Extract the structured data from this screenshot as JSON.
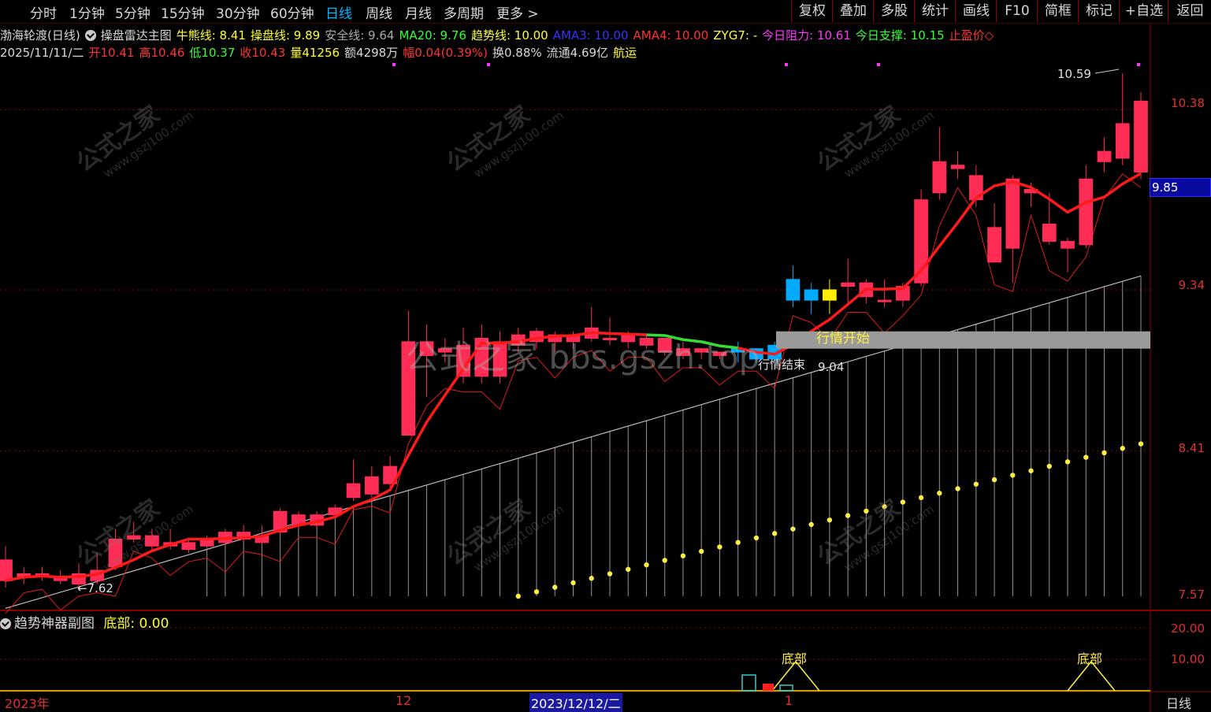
{
  "tabs": [
    "分时",
    "1分钟",
    "5分钟",
    "15分钟",
    "30分钟",
    "60分钟",
    "日线",
    "周线",
    "月线",
    "多周期",
    "更多 >"
  ],
  "active_tab": "日线",
  "right_buttons": [
    "复权",
    "叠加",
    "多股",
    "统计",
    "画线",
    "F10",
    "简框",
    "标记",
    "+自选",
    "返回"
  ],
  "indicator_line": {
    "stock": "渤海轮渡(日线)",
    "formula": "操盘雷达主图",
    "items": [
      {
        "text": "牛熊线: 8.41",
        "color": "#ffff33"
      },
      {
        "text": "操盘线: 9.89",
        "color": "#ffff33"
      },
      {
        "text": "安全线: 9.64",
        "color": "#aaaaaa"
      },
      {
        "text": "MA20: 9.76",
        "color": "#33ff33"
      },
      {
        "text": "趋势线: 10.00",
        "color": "#ffff33"
      },
      {
        "text": "AMA3: 10.00",
        "color": "#3333ff"
      },
      {
        "text": "AMA4: 10.00",
        "color": "#ff3333"
      },
      {
        "text": "ZYG7: -",
        "color": "#ffff33"
      },
      {
        "text": "今日阻力: 10.61",
        "color": "#ff33ff"
      },
      {
        "text": "今日支撑: 10.15",
        "color": "#33ff33"
      },
      {
        "text": "止盈价◇",
        "color": "#ff3333"
      }
    ]
  },
  "quote_line": {
    "date": "2025/11/11/二",
    "items": [
      {
        "text": "开10.41",
        "color": "#ff3333"
      },
      {
        "text": "高10.46",
        "color": "#ff3333"
      },
      {
        "text": "低10.37",
        "color": "#33ff33"
      },
      {
        "text": "收10.43",
        "color": "#ff3333"
      },
      {
        "text": "量41256",
        "color": "#ffff33"
      },
      {
        "text": "额4298万",
        "color": "#d8d8d8"
      },
      {
        "text": "幅0.04(0.39%)",
        "color": "#ff3333"
      },
      {
        "text": "换0.88%",
        "color": "#d8d8d8"
      },
      {
        "text": "流通4.69亿",
        "color": "#d8d8d8"
      },
      {
        "text": "航运",
        "color": "#ffff33"
      }
    ]
  },
  "y_axis_labels": [
    "10.38",
    "9.34",
    "8.41",
    "7.57"
  ],
  "current_price_tag": "9.85",
  "annotations": {
    "high_label": "10.59",
    "low_label": "7.62",
    "start_label": "行情开始",
    "end_label": "行情结束",
    "end_value": "9.04"
  },
  "sub_chart": {
    "title": "趋势神器副图",
    "value_label": "底部: 0.00",
    "y_labels": [
      "20.00",
      "10.00"
    ],
    "marker_label": "底部"
  },
  "x_axis_labels": [
    "2023年",
    "12",
    "2023/12/12/二",
    "1"
  ],
  "period_label": "日线",
  "watermark": {
    "title": "公式之家",
    "url": "www.gszj100.com",
    "big": "公式之家 bbs.gszh.top"
  },
  "colors": {
    "up": "#ff2d55",
    "down": "#00aaff",
    "ma": "#ff1a1a",
    "grid": "#8b0000",
    "accent": "#00b4ff"
  },
  "candles": [
    {
      "o": 7.78,
      "c": 7.66,
      "h": 7.86,
      "l": 7.62
    },
    {
      "o": 7.68,
      "c": 7.7,
      "h": 7.74,
      "l": 7.64
    },
    {
      "o": 7.7,
      "c": 7.7,
      "h": 7.74,
      "l": 7.66
    },
    {
      "o": 7.68,
      "c": 7.66,
      "h": 7.72,
      "l": 7.64
    },
    {
      "o": 7.64,
      "c": 7.7,
      "h": 7.76,
      "l": 7.62
    },
    {
      "o": 7.66,
      "c": 7.72,
      "h": 7.82,
      "l": 7.64
    },
    {
      "o": 7.74,
      "c": 7.9,
      "h": 7.96,
      "l": 7.72
    },
    {
      "o": 7.9,
      "c": 7.92,
      "h": 8.0,
      "l": 7.88
    },
    {
      "o": 7.86,
      "c": 7.92,
      "h": 7.96,
      "l": 7.84
    },
    {
      "o": 7.86,
      "c": 7.88,
      "h": 7.96,
      "l": 7.84
    },
    {
      "o": 7.84,
      "c": 7.88,
      "h": 7.9,
      "l": 7.82
    },
    {
      "o": 7.86,
      "c": 7.9,
      "h": 7.92,
      "l": 7.84
    },
    {
      "o": 7.88,
      "c": 7.94,
      "h": 7.96,
      "l": 7.86
    },
    {
      "o": 7.9,
      "c": 7.94,
      "h": 7.98,
      "l": 7.88
    },
    {
      "o": 7.88,
      "c": 7.92,
      "h": 7.98,
      "l": 7.86
    },
    {
      "o": 7.94,
      "c": 8.06,
      "h": 8.08,
      "l": 7.92
    },
    {
      "o": 7.98,
      "c": 8.04,
      "h": 8.06,
      "l": 7.96
    },
    {
      "o": 7.98,
      "c": 8.04,
      "h": 8.06,
      "l": 7.96
    },
    {
      "o": 8.04,
      "c": 8.08,
      "h": 8.1,
      "l": 8.02
    },
    {
      "o": 8.14,
      "c": 8.22,
      "h": 8.36,
      "l": 8.12
    },
    {
      "o": 8.16,
      "c": 8.26,
      "h": 8.32,
      "l": 8.14
    },
    {
      "o": 8.22,
      "c": 8.32,
      "h": 8.38,
      "l": 8.2
    },
    {
      "o": 8.5,
      "c": 9.04,
      "h": 9.22,
      "l": 8.5
    },
    {
      "o": 8.96,
      "c": 9.04,
      "h": 9.14,
      "l": 8.72
    },
    {
      "o": 8.98,
      "c": 9.0,
      "h": 9.06,
      "l": 8.92
    },
    {
      "o": 8.84,
      "c": 9.02,
      "h": 9.12,
      "l": 8.8
    },
    {
      "o": 8.84,
      "c": 9.06,
      "h": 9.14,
      "l": 8.8
    },
    {
      "o": 8.84,
      "c": 9.04,
      "h": 9.1,
      "l": 8.8
    },
    {
      "o": 9.02,
      "c": 9.08,
      "h": 9.12,
      "l": 8.98
    },
    {
      "o": 9.04,
      "c": 9.1,
      "h": 9.12,
      "l": 9.0
    },
    {
      "o": 9.04,
      "c": 9.08,
      "h": 9.1,
      "l": 8.98
    },
    {
      "o": 9.04,
      "c": 9.08,
      "h": 9.1,
      "l": 9.0
    },
    {
      "o": 9.06,
      "c": 9.12,
      "h": 9.24,
      "l": 9.04
    },
    {
      "o": 9.06,
      "c": 9.06,
      "h": 9.18,
      "l": 9.02
    },
    {
      "o": 9.04,
      "c": 9.08,
      "h": 9.1,
      "l": 9.0
    },
    {
      "o": 9.02,
      "c": 9.06,
      "h": 9.08,
      "l": 9.0
    },
    {
      "o": 8.98,
      "c": 9.06,
      "h": 9.06,
      "l": 8.96
    },
    {
      "o": 8.96,
      "c": 9.0,
      "h": 9.04,
      "l": 8.94
    },
    {
      "o": 8.98,
      "c": 9.0,
      "h": 9.0,
      "l": 8.94
    },
    {
      "o": 8.98,
      "c": 8.96,
      "h": 8.98,
      "l": 8.94
    },
    {
      "o": 8.98,
      "c": 9.0,
      "h": 9.04,
      "l": 8.92
    },
    {
      "o": 9.0,
      "c": 8.94,
      "h": 9.0,
      "l": 8.92
    },
    {
      "o": 9.02,
      "c": 8.94,
      "h": 9.04,
      "l": 8.92
    },
    {
      "o": 9.4,
      "c": 9.28,
      "h": 9.48,
      "l": 9.24
    },
    {
      "o": 9.28,
      "c": 9.34,
      "h": 9.38,
      "l": 9.2
    },
    {
      "o": 9.28,
      "c": 9.34,
      "h": 9.4,
      "l": 9.2
    },
    {
      "o": 9.36,
      "c": 9.38,
      "h": 9.52,
      "l": 9.26
    },
    {
      "o": 9.3,
      "c": 9.38,
      "h": 9.4,
      "l": 9.26
    },
    {
      "o": 9.28,
      "c": 9.28,
      "h": 9.4,
      "l": 9.24
    },
    {
      "o": 9.28,
      "c": 9.36,
      "h": 9.38,
      "l": 9.24
    },
    {
      "o": 9.38,
      "c": 9.86,
      "h": 9.92,
      "l": 9.36
    },
    {
      "o": 9.9,
      "c": 10.08,
      "h": 10.28,
      "l": 9.86
    },
    {
      "o": 10.04,
      "c": 10.06,
      "h": 10.14,
      "l": 9.98
    },
    {
      "o": 9.86,
      "c": 10.0,
      "h": 10.06,
      "l": 9.82
    },
    {
      "o": 9.5,
      "c": 9.7,
      "h": 9.84,
      "l": 9.52
    },
    {
      "o": 9.58,
      "c": 9.98,
      "h": 10.0,
      "l": 9.38
    },
    {
      "o": 9.9,
      "c": 9.92,
      "h": 9.96,
      "l": 9.82
    },
    {
      "o": 9.62,
      "c": 9.72,
      "h": 9.9,
      "l": 9.6
    },
    {
      "o": 9.58,
      "c": 9.62,
      "h": 9.64,
      "l": 9.44
    },
    {
      "o": 9.6,
      "c": 9.98,
      "h": 10.06,
      "l": 9.58
    },
    {
      "o": 10.08,
      "c": 10.14,
      "h": 10.22,
      "l": 10.02
    },
    {
      "o": 10.1,
      "c": 10.3,
      "h": 10.59,
      "l": 10.06
    },
    {
      "o": 10.43,
      "c": 10.02,
      "h": 10.48,
      "l": 9.98
    }
  ],
  "down_colors_blue": [
    40,
    41,
    42,
    43,
    44,
    45
  ]
}
